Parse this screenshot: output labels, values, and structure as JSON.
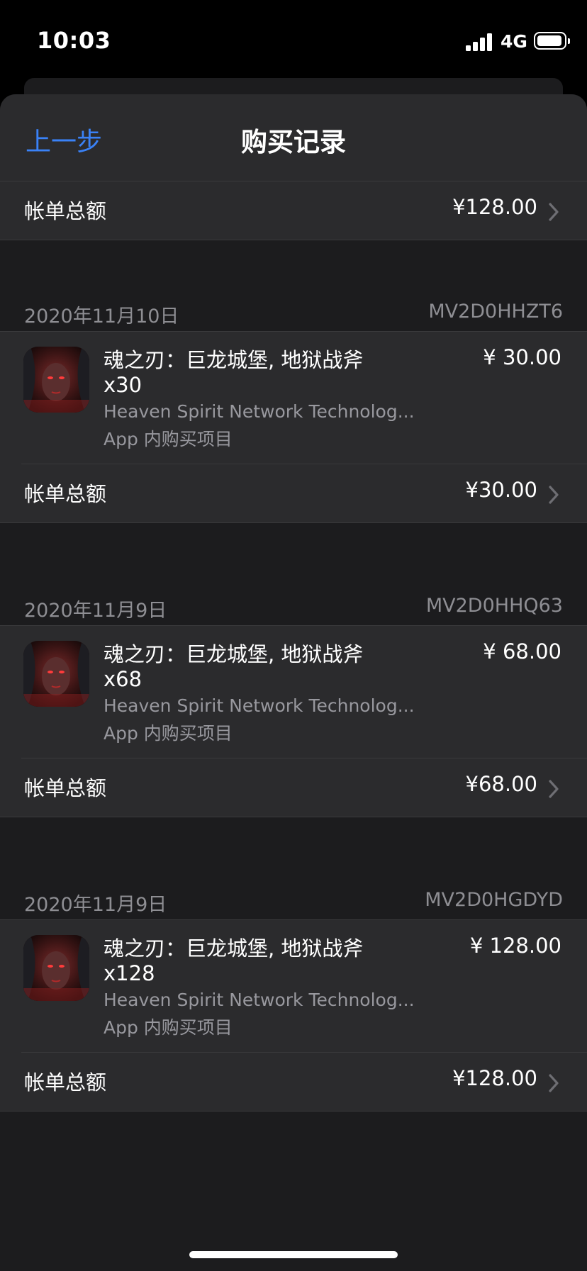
{
  "status_bar": {
    "time": "10:03",
    "network": "4G"
  },
  "nav": {
    "back_label": "上一步",
    "title": "购买记录"
  },
  "top_total": {
    "label": "帐单总额",
    "amount": "¥128.00"
  },
  "purchases": [
    {
      "date": "2020年11月10日",
      "order_id": "MV2D0HHZT6",
      "item": {
        "name": "魂之刃：巨龙城堡, 地狱战斧",
        "quantity": "x30",
        "developer": "Heaven Spirit Network Technolog...",
        "kind": "App 内购买项目",
        "price": "¥ 30.00"
      },
      "total_label": "帐单总额",
      "total_amount": "¥30.00"
    },
    {
      "date": "2020年11月9日",
      "order_id": "MV2D0HHQ63",
      "item": {
        "name": "魂之刃：巨龙城堡, 地狱战斧",
        "quantity": "x68",
        "developer": "Heaven Spirit Network Technolog...",
        "kind": "App 内购买项目",
        "price": "¥ 68.00"
      },
      "total_label": "帐单总额",
      "total_amount": "¥68.00"
    },
    {
      "date": "2020年11月9日",
      "order_id": "MV2D0HGDYD",
      "item": {
        "name": "魂之刃：巨龙城堡, 地狱战斧",
        "quantity": "x128",
        "developer": "Heaven Spirit Network Technolog...",
        "kind": "App 内购买项目",
        "price": "¥ 128.00"
      },
      "total_label": "帐单总额",
      "total_amount": "¥128.00"
    }
  ],
  "colors": {
    "accent": "#3a82f7",
    "background": "#1c1c1e",
    "cell": "#2b2b2d",
    "secondary_text": "#8e8e93"
  },
  "icons": {
    "chevron": "chevron-right-icon",
    "app": "soul-blade-app-icon"
  }
}
